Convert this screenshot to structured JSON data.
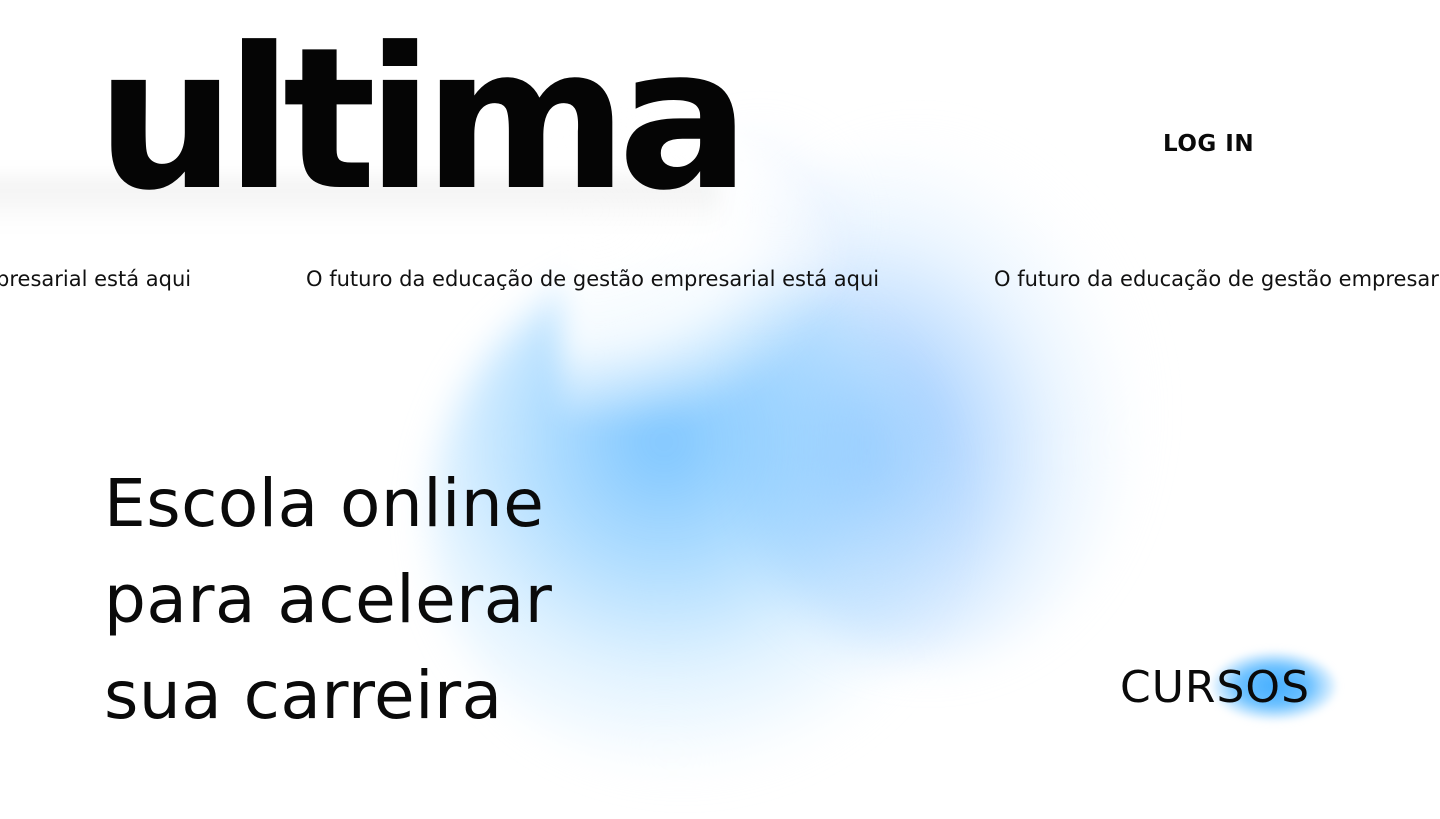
{
  "header": {
    "logo_text": "ultima",
    "login_label": "LOG IN"
  },
  "marquee": {
    "items": [
      "O futuro da educação de gestão empresarial está aqui",
      "O futuro da educação de gestão empresarial está aqui",
      "O futuro da educação de gestão empresarial está aqui"
    ]
  },
  "hero": {
    "headline_lines": [
      "Escola online",
      "para acelerar",
      "sua carreira"
    ],
    "courses_label": "CURSOS"
  },
  "colors": {
    "text": "#0a0a0a",
    "accent_blue": "#46afff",
    "background": "#ffffff"
  }
}
